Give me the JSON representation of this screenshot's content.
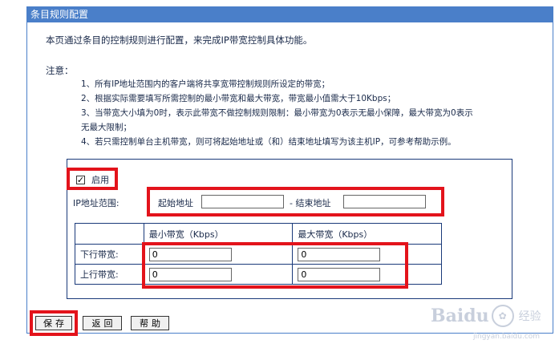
{
  "window": {
    "title": "条目规则配置"
  },
  "intro": "本页通过条目的控制规则进行配置，来完成IP带宽控制具体功能。",
  "notice": {
    "heading": "注意：",
    "lines": [
      "1、所有IP地址范围内的客户端将共享宽带控制规则所设定的带宽；",
      "2、根据实际需要填写所需控制的最小带宽和最大带宽，带宽最小值需大于10Kbps；",
      "3、当带宽大小填为0时，表示此带宽不做控制规则限制：最小带宽为0表示无最小保障，最大带宽为0表示",
      "无最大限制；",
      "4、若只需控制单台主机带宽，则可将起始地址或（和）结束地址填写为该主机IP，可参考帮助示例。"
    ]
  },
  "enable": {
    "label": "启用",
    "checked": true
  },
  "ip_range": {
    "label": "IP地址范围:",
    "start_label": "起始地址",
    "start_value": "",
    "separator": "- 结束地址",
    "end_value": ""
  },
  "bandwidth": {
    "min_header": "最小带宽（Kbps）",
    "max_header": "最大带宽（Kbps）",
    "rows": [
      {
        "label": "下行带宽:",
        "min": "0",
        "max": "0"
      },
      {
        "label": "上行带宽:",
        "min": "0",
        "max": "0"
      }
    ]
  },
  "buttons": {
    "save": "保存",
    "back": "返回",
    "help": "帮助"
  },
  "watermark": {
    "brand": "Baidu",
    "suffix": "经验",
    "url": "jingyan.baidu.com"
  },
  "colors": {
    "title_bar": "#4a7fc9",
    "highlight": "#e3131b",
    "border": "#1a3a7a"
  }
}
